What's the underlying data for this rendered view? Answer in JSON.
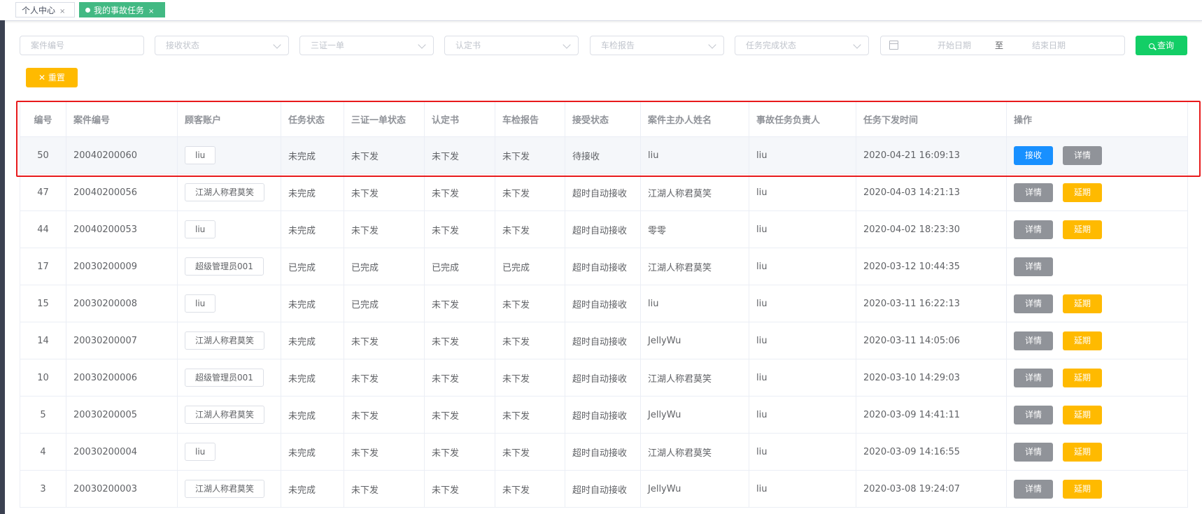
{
  "tabs": [
    {
      "label": "个人中心",
      "close": "×",
      "active": false
    },
    {
      "label": "我的事故任务",
      "close": "×",
      "active": true
    }
  ],
  "filters": {
    "case_no_placeholder": "案件编号",
    "receive_status": "接收状态",
    "three_cert": "三证一单",
    "certificate": "认定书",
    "inspection_report": "车检报告",
    "task_status": "任务完成状态",
    "start_date": "开始日期",
    "range_sep": "至",
    "end_date": "结束日期",
    "query_label": "查询",
    "reset_label": "重置"
  },
  "table": {
    "headers": [
      "编号",
      "案件编号",
      "顾客账户",
      "任务状态",
      "三证一单状态",
      "认定书",
      "车检报告",
      "接受状态",
      "案件主办人姓名",
      "事故任务负责人",
      "任务下发时间",
      "操作"
    ],
    "rows": [
      {
        "id": "50",
        "case_no": "20040200060",
        "account": "liu",
        "task_status": "未完成",
        "three_cert": "未下发",
        "certificate": "未下发",
        "inspection": "未下发",
        "accept_status": "待接收",
        "handler": "liu",
        "owner": "liu",
        "time": "2020-04-21 16:09:13",
        "highlight": true,
        "ops": [
          {
            "label": "接收",
            "variant": "primary"
          },
          {
            "label": "详情",
            "variant": "info"
          }
        ]
      },
      {
        "id": "47",
        "case_no": "20040200056",
        "account": "江湖人称君莫笑",
        "task_status": "未完成",
        "three_cert": "未下发",
        "certificate": "未下发",
        "inspection": "未下发",
        "accept_status": "超时自动接收",
        "handler": "江湖人称君莫笑",
        "owner": "liu",
        "time": "2020-04-03 14:21:13",
        "highlight": false,
        "ops": [
          {
            "label": "详情",
            "variant": "info"
          },
          {
            "label": "延期",
            "variant": "warning"
          }
        ]
      },
      {
        "id": "44",
        "case_no": "20040200053",
        "account": "liu",
        "task_status": "未完成",
        "three_cert": "未下发",
        "certificate": "未下发",
        "inspection": "未下发",
        "accept_status": "超时自动接收",
        "handler": "零零",
        "owner": "liu",
        "time": "2020-04-02 18:23:30",
        "highlight": false,
        "ops": [
          {
            "label": "详情",
            "variant": "info"
          },
          {
            "label": "延期",
            "variant": "warning"
          }
        ]
      },
      {
        "id": "17",
        "case_no": "20030200009",
        "account": "超级管理员001",
        "task_status": "已完成",
        "three_cert": "已完成",
        "certificate": "已完成",
        "inspection": "已完成",
        "accept_status": "超时自动接收",
        "handler": "江湖人称君莫笑",
        "owner": "liu",
        "time": "2020-03-12 10:44:35",
        "highlight": false,
        "ops": [
          {
            "label": "详情",
            "variant": "info"
          }
        ]
      },
      {
        "id": "15",
        "case_no": "20030200008",
        "account": "liu",
        "task_status": "未完成",
        "three_cert": "已完成",
        "certificate": "未下发",
        "inspection": "未下发",
        "accept_status": "超时自动接收",
        "handler": "liu",
        "owner": "liu",
        "time": "2020-03-11 16:22:13",
        "highlight": false,
        "ops": [
          {
            "label": "详情",
            "variant": "info"
          },
          {
            "label": "延期",
            "variant": "warning"
          }
        ]
      },
      {
        "id": "14",
        "case_no": "20030200007",
        "account": "江湖人称君莫笑",
        "task_status": "未完成",
        "three_cert": "未下发",
        "certificate": "未下发",
        "inspection": "未下发",
        "accept_status": "超时自动接收",
        "handler": "JellyWu",
        "owner": "liu",
        "time": "2020-03-11 14:05:06",
        "highlight": false,
        "ops": [
          {
            "label": "详情",
            "variant": "info"
          },
          {
            "label": "延期",
            "variant": "warning"
          }
        ]
      },
      {
        "id": "10",
        "case_no": "20030200006",
        "account": "超级管理员001",
        "task_status": "未完成",
        "three_cert": "未下发",
        "certificate": "未下发",
        "inspection": "未下发",
        "accept_status": "超时自动接收",
        "handler": "江湖人称君莫笑",
        "owner": "liu",
        "time": "2020-03-10 14:29:03",
        "highlight": false,
        "ops": [
          {
            "label": "详情",
            "variant": "info"
          },
          {
            "label": "延期",
            "variant": "warning"
          }
        ]
      },
      {
        "id": "5",
        "case_no": "20030200005",
        "account": "江湖人称君莫笑",
        "task_status": "未完成",
        "three_cert": "未下发",
        "certificate": "未下发",
        "inspection": "未下发",
        "accept_status": "超时自动接收",
        "handler": "JellyWu",
        "owner": "liu",
        "time": "2020-03-09 14:41:11",
        "highlight": false,
        "ops": [
          {
            "label": "详情",
            "variant": "info"
          },
          {
            "label": "延期",
            "variant": "warning"
          }
        ]
      },
      {
        "id": "4",
        "case_no": "20030200004",
        "account": "liu",
        "task_status": "未完成",
        "three_cert": "未下发",
        "certificate": "未下发",
        "inspection": "未下发",
        "accept_status": "超时自动接收",
        "handler": "江湖人称君莫笑",
        "owner": "liu",
        "time": "2020-03-09 14:16:55",
        "highlight": false,
        "ops": [
          {
            "label": "详情",
            "variant": "info"
          },
          {
            "label": "延期",
            "variant": "warning"
          }
        ]
      },
      {
        "id": "3",
        "case_no": "20030200003",
        "account": "江湖人称君莫笑",
        "task_status": "未完成",
        "three_cert": "未下发",
        "certificate": "未下发",
        "inspection": "未下发",
        "accept_status": "超时自动接收",
        "handler": "JellyWu",
        "owner": "liu",
        "time": "2020-03-08 19:24:07",
        "highlight": false,
        "ops": [
          {
            "label": "详情",
            "variant": "info"
          },
          {
            "label": "延期",
            "variant": "warning"
          }
        ]
      }
    ]
  },
  "colors": {
    "primary": "#1890ff",
    "success": "#13ce66",
    "warning": "#ffba00",
    "info": "#909399",
    "tab_active": "#42b983",
    "highlight_border": "#e8191b"
  }
}
